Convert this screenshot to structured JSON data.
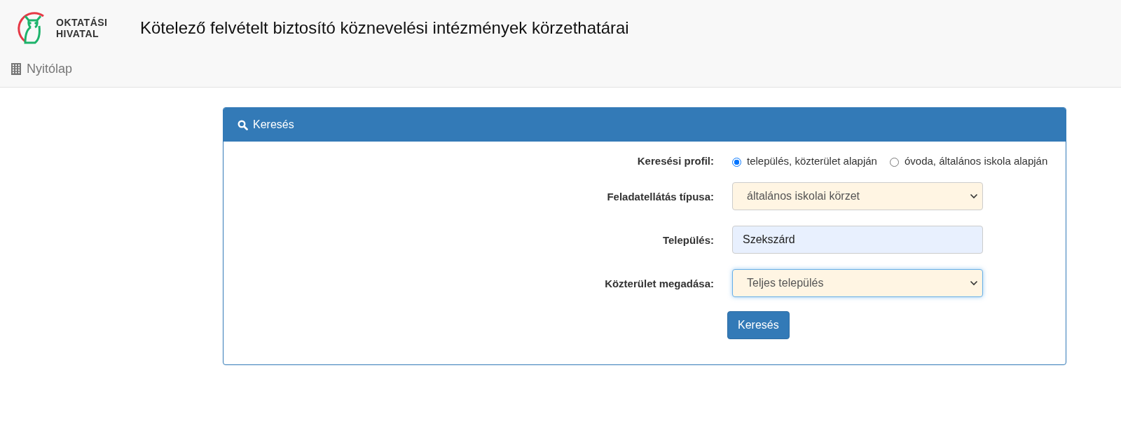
{
  "header": {
    "logo_text": [
      "OKTATÁSI",
      "HIVATAL"
    ],
    "title": "Kötelező felvételt biztosító köznevelési intézmények körzethatárai"
  },
  "nav": {
    "home": "Nyitólap"
  },
  "panel": {
    "title": "Keresés",
    "fields": [
      {
        "kind": "radio",
        "label": "Keresési profil:",
        "options": [
          {
            "label": "település, közterület alapján",
            "selected": true
          },
          {
            "label": "óvoda, általános iskola alapján",
            "selected": false
          }
        ]
      },
      {
        "kind": "select",
        "label": "Feladatellátás típusa:",
        "value": "általános iskolai körzet",
        "focused": false
      },
      {
        "kind": "text",
        "label": "Település:",
        "value": "Szekszárd"
      },
      {
        "kind": "select",
        "label": "Közterület megadása:",
        "value": "Teljes település",
        "focused": true
      }
    ],
    "submit": "Keresés"
  }
}
